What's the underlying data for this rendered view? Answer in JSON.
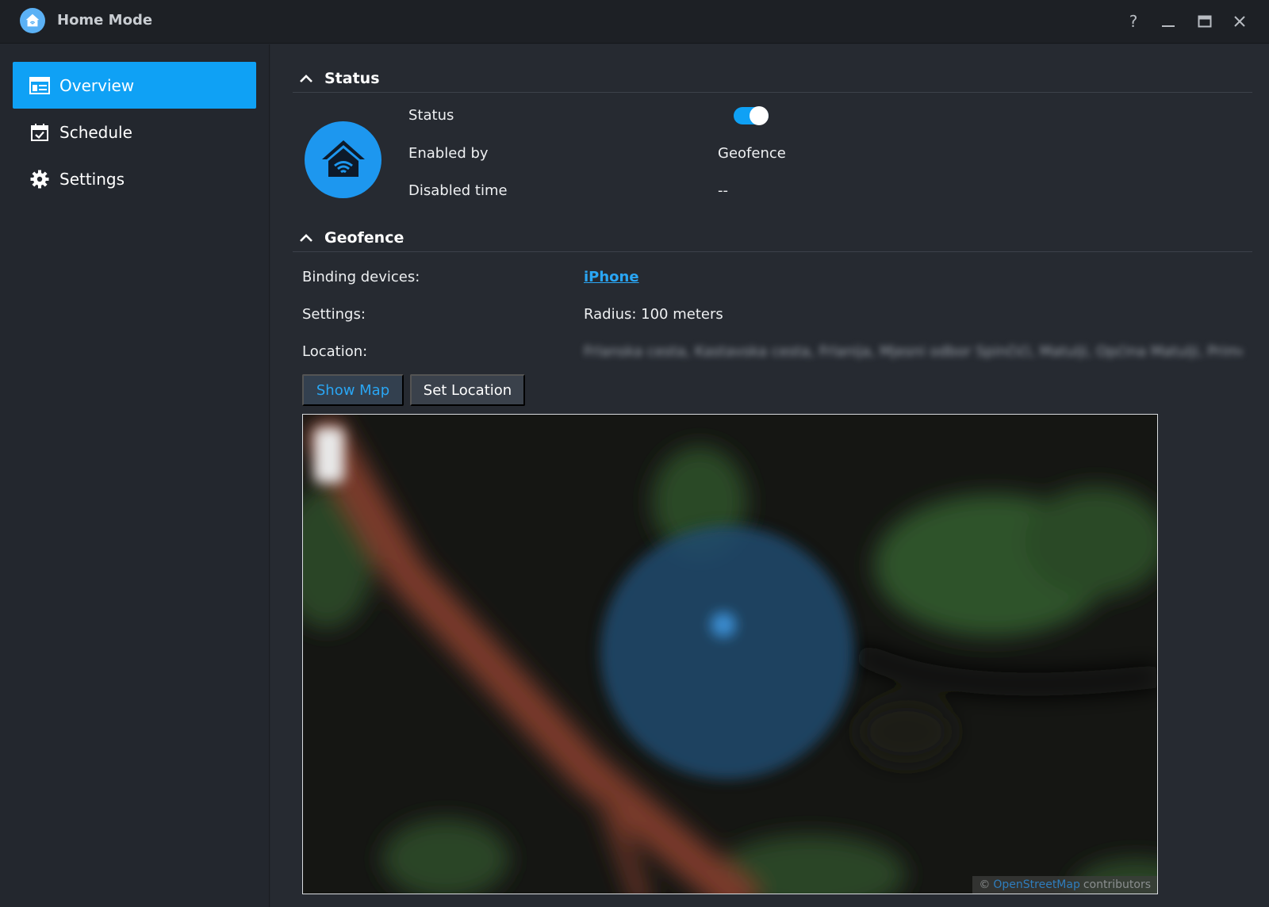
{
  "window": {
    "title": "Home Mode",
    "controls": {
      "help": "?",
      "minimize": "–",
      "maximize": "□",
      "close": "✕"
    }
  },
  "sidebar": {
    "items": [
      {
        "label": "Overview",
        "icon": "overview-icon",
        "active": true
      },
      {
        "label": "Schedule",
        "icon": "calendar-check-icon",
        "active": false
      },
      {
        "label": "Settings",
        "icon": "gear-icon",
        "active": false
      }
    ]
  },
  "status_section": {
    "title": "Status",
    "rows": [
      {
        "label": "Status",
        "value": ""
      },
      {
        "label": "Enabled by",
        "value": "Geofence"
      },
      {
        "label": "Disabled time",
        "value": "--"
      }
    ],
    "status_enabled": true
  },
  "geofence_section": {
    "title": "Geofence",
    "binding_label": "Binding devices:",
    "binding_value": "iPhone",
    "settings_label": "Settings:",
    "settings_value": "Radius: 100 meters",
    "location_label": "Location:",
    "location_value": "Frlanska cesta, Kastavska cesta, Frlanija, Mjesni odbor Spinčići, Matulji, Općina Matulji, Primor...",
    "show_map_label": "Show Map",
    "set_location_label": "Set Location"
  },
  "map": {
    "attribution_prefix": "©",
    "attribution_link": "OpenStreetMap",
    "attribution_suffix": "contributors"
  },
  "colors": {
    "accent": "#0fa1f5",
    "link": "#2aa6f4",
    "background": "#262a31",
    "titlebar": "#1d2025"
  }
}
